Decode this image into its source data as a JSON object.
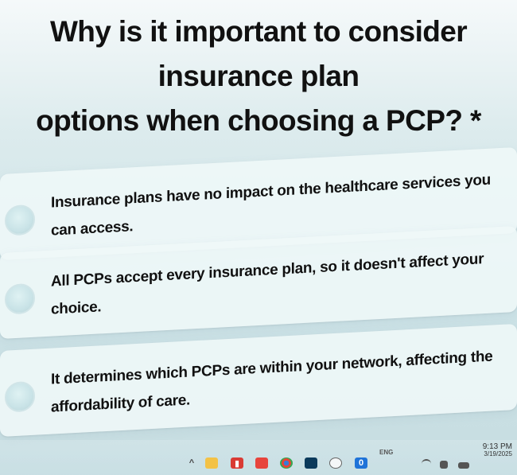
{
  "question": {
    "line1": "Why is it important to consider insurance plan",
    "line2": "options when choosing a PCP? *"
  },
  "options": [
    {
      "text": "Insurance plans have no impact on the healthcare services you can access."
    },
    {
      "text": "All PCPs accept every insurance plan, so it doesn't affect your choice."
    },
    {
      "text": "It determines which PCPs are within your network, affecting the affordability of care."
    }
  ],
  "taskbar": {
    "language": "ENG",
    "time": "9:13 PM",
    "date": "3/19/2025"
  },
  "icons": [
    "chevron-up-icon",
    "folder-icon",
    "app-icon-red",
    "chrome-icon",
    "store-icon",
    "cloud-icon",
    "app-icon-blue",
    "wifi-icon",
    "speaker-icon",
    "battery-icon"
  ]
}
